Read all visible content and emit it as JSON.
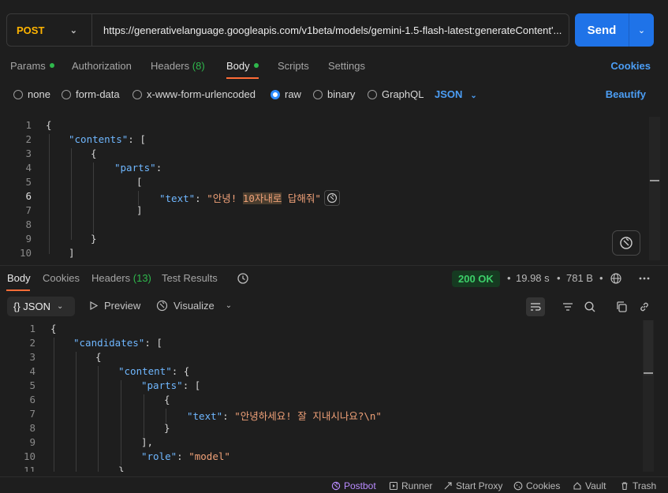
{
  "request": {
    "method": "POST",
    "url": "https://generativelanguage.googleapis.com/v1beta/models/gemini-1.5-flash-latest:generateContent'...",
    "send_label": "Send"
  },
  "request_tabs": {
    "params": "Params",
    "authorization": "Authorization",
    "headers": "Headers",
    "headers_count": "(8)",
    "body": "Body",
    "scripts": "Scripts",
    "settings": "Settings",
    "cookies": "Cookies"
  },
  "body_types": {
    "none": "none",
    "form_data": "form-data",
    "urlencoded": "x-www-form-urlencoded",
    "raw": "raw",
    "binary": "binary",
    "graphql": "GraphQL",
    "format": "JSON",
    "beautify": "Beautify"
  },
  "request_body": {
    "line_numbers": [
      "1",
      "2",
      "3",
      "4",
      "5",
      "6",
      "7",
      "8",
      "9",
      "10"
    ],
    "brace_open": "{",
    "key_contents": "\"contents\"",
    "colon_bracket": ": [",
    "brace_inner_open": "{",
    "key_parts": "\"parts\"",
    "colon": ":",
    "bracket_open": "[",
    "key_text": "\"text\"",
    "colon_sp": ": ",
    "val_prefix": "\"안녕! ",
    "val_highlight": "10자내로",
    "val_suffix": " 답해줘\"",
    "bracket_close": "]",
    "brace_inner_close": "}",
    "bracket_end": "]"
  },
  "response_tabs": {
    "body": "Body",
    "cookies": "Cookies",
    "headers": "Headers",
    "headers_count": "(13)",
    "test_results": "Test Results",
    "status": "200 OK",
    "time": "19.98 s",
    "size": "781 B",
    "separator": "•"
  },
  "response_toolbar": {
    "format": "{} JSON",
    "preview": "Preview",
    "visualize": "Visualize"
  },
  "response_body": {
    "line_numbers": [
      "1",
      "2",
      "3",
      "4",
      "5",
      "6",
      "7",
      "8",
      "9",
      "10",
      "11"
    ],
    "l1": "{",
    "k_candidates": "\"candidates\"",
    "p_colon_bracket": ": [",
    "l3": "{",
    "k_content": "\"content\"",
    "p_colon_brace": ": {",
    "k_parts": "\"parts\"",
    "l6": "{",
    "k_text": "\"text\"",
    "p_colon_sp": ": ",
    "v_text": "\"안녕하세요! 잘 지내시나요?\\n\"",
    "l8": "}",
    "l9": "],",
    "k_role": "\"role\"",
    "v_role": "\"model\"",
    "l11": "},"
  },
  "statusbar": {
    "postbot": "Postbot",
    "runner": "Runner",
    "start_proxy": "Start Proxy",
    "cookies": "Cookies",
    "vault": "Vault",
    "trash": "Trash"
  },
  "colors": {
    "accent_orange": "#ff6c37",
    "send_blue": "#1f73e8",
    "link_blue": "#4c9ef5",
    "method_yellow": "#ffb400",
    "status_green": "#3dd06a"
  }
}
